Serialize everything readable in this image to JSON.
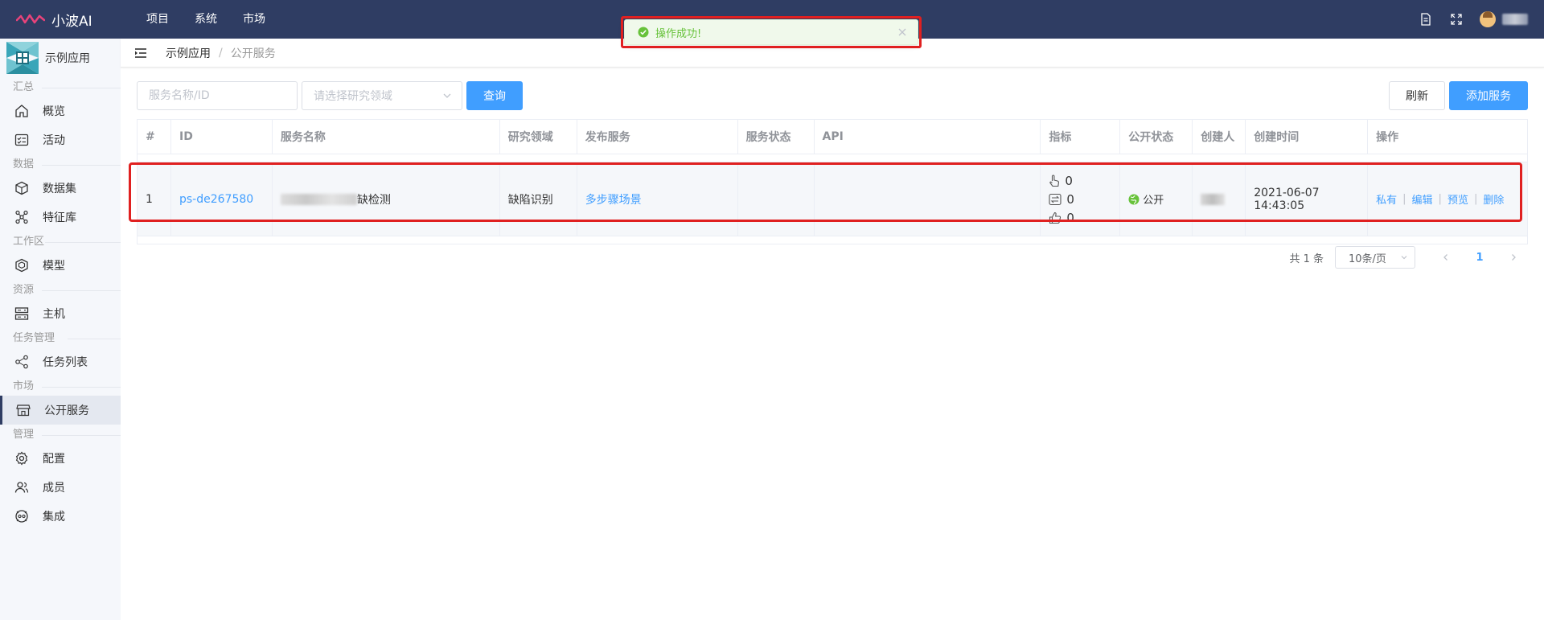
{
  "topbar": {
    "app_title": "小波AI",
    "nav": [
      "项目",
      "系统",
      "市场"
    ]
  },
  "toast": {
    "message": "操作成功!"
  },
  "sidebar": {
    "app_name": "示例应用",
    "groups": [
      {
        "title": "汇总",
        "items": [
          "概览",
          "活动"
        ]
      },
      {
        "title": "数据",
        "items": [
          "数据集",
          "特征库"
        ]
      },
      {
        "title": "工作区",
        "items": [
          "模型"
        ]
      },
      {
        "title": "资源",
        "items": [
          "主机"
        ]
      },
      {
        "title": "任务管理",
        "items": [
          "任务列表"
        ]
      },
      {
        "title": "市场",
        "items": [
          "公开服务"
        ]
      },
      {
        "title": "管理",
        "items": [
          "配置",
          "成员",
          "集成"
        ]
      }
    ],
    "active_item": "公开服务"
  },
  "breadcrumb": [
    "示例应用",
    "公开服务"
  ],
  "search": {
    "name_placeholder": "服务名称/ID",
    "domain_placeholder": "请选择研究领域",
    "query_label": "查询"
  },
  "actions": {
    "refresh_label": "刷新",
    "add_label": "添加服务"
  },
  "table": {
    "headers": [
      "#",
      "ID",
      "服务名称",
      "研究领域",
      "发布服务",
      "服务状态",
      "API",
      "指标",
      "公开状态",
      "创建人",
      "创建时间",
      "操作"
    ],
    "rows": [
      {
        "index": "1",
        "id": "ps-de267580",
        "name_suffix": "缺检测",
        "domain": "缺陷识别",
        "publish": "多步骤场景",
        "status": "",
        "api": "",
        "metrics": {
          "clicks": "0",
          "calls": "0",
          "likes": "0"
        },
        "public_status": "公开",
        "created_at": "2021-06-07 14:43:05",
        "ops": [
          "私有",
          "编辑",
          "预览",
          "删除"
        ]
      }
    ]
  },
  "pagination": {
    "total": "共 1 条",
    "page_size": "10条/页",
    "current": "1"
  },
  "colors": {
    "topbar": "#2f3d63",
    "primary": "#409eff",
    "success": "#67c23a",
    "highlight": "#e02020"
  }
}
